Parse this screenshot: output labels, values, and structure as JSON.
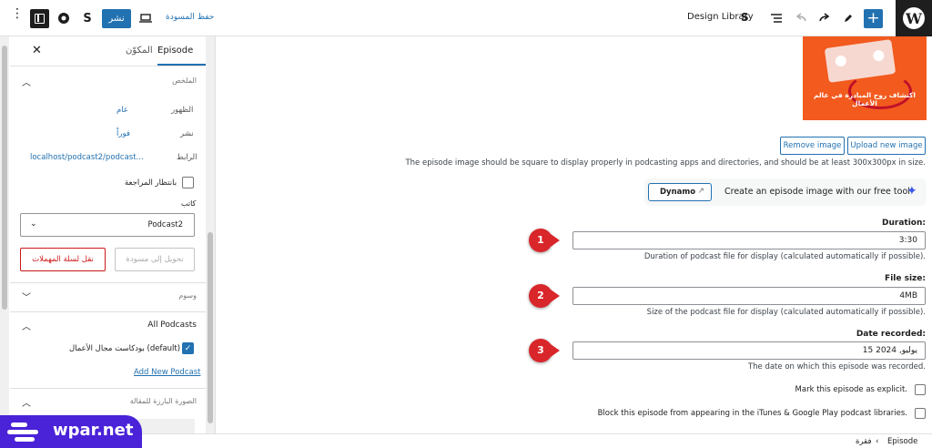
{
  "topbar": {
    "design_library": "Design Library",
    "publish_label": "نشر",
    "save_draft_label": "حفظ المسودة",
    "icons": [
      "wordpress-logo",
      "add-block-icon",
      "pencil-icon",
      "redo-icon",
      "undo-icon",
      "document-overview-icon",
      "stackable-icon",
      "desktop-icon",
      "yoast-icon",
      "sidebar-settings-icon",
      "options-icon"
    ]
  },
  "sidebar": {
    "tab_episode": "Episode",
    "tab_block": "المكوّن",
    "summary_title": "الملخص",
    "visibility_label": "الظهور",
    "visibility_value": "عام",
    "publish_label": "نشر",
    "publish_value": "فوراً",
    "link_label": "الرابط",
    "link_value": "localhost/podcast2/podcast...",
    "pending_review": "بانتظار المراجعة",
    "author_label": "كاتب",
    "author_value": "Podcast2",
    "switch_to_draft": "تحويل إلى مسودة",
    "move_to_trash": "نقل لسلة المهملات",
    "tags_title": "وسوم",
    "podcasts_title": "All Podcasts",
    "podcast_option": "بودكاست مجال الأعمال (default)",
    "add_new_podcast": "Add New Podcast",
    "featured_image_title": "الصورة البارزة للمقالة"
  },
  "main": {
    "episode_image_caption": "اكتشاف روح المبادرة في عالم الأعمال",
    "upload_new_image": "Upload new image",
    "remove_image": "Remove image",
    "image_help": "The episode image should be square to display properly in podcasting apps and directories, and should be at least 300x300px in size.",
    "dynamo_label": "Dynamo",
    "dynamo_text": "Create an episode image with our free tool",
    "duration_label": "Duration:",
    "duration_value": "3:30",
    "duration_help": "Duration of podcast file for display (calculated automatically if possible).",
    "filesize_label": "File size:",
    "filesize_value": "4MB",
    "filesize_help": "Size of the podcast file for display (calculated automatically if possible).",
    "date_label": "Date recorded:",
    "date_value": "15 يوليو, 2024",
    "date_help": "The date on which this episode was recorded.",
    "explicit_label": "Mark this episode as explicit.",
    "block_label": "Block this episode from appearing in the iTunes & Google Play podcast libraries.",
    "markers": [
      "1",
      "2",
      "3"
    ]
  },
  "footer": {
    "crumb_episode": "Episode",
    "crumb_sep": "‹",
    "crumb_paragraph": "فقرة"
  },
  "watermark": {
    "text": "wpar.net"
  },
  "colors": {
    "accent": "#2271b1",
    "marker": "#d9262b",
    "danger": "#cc1818",
    "watermark": "#4a22d8"
  }
}
